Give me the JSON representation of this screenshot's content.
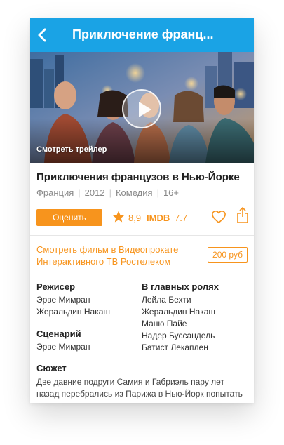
{
  "header": {
    "title": "Приключение франц...",
    "back_icon": "chevron-left-icon"
  },
  "hero": {
    "trailer_label": "Смотреть трейлер",
    "play_icon": "play-icon"
  },
  "movie": {
    "title": "Приключения французов в Нью-Йорке",
    "country": "Франция",
    "year": "2012",
    "genre": "Комедия",
    "age_rating": "16+"
  },
  "actions": {
    "rate_label": "Оценить",
    "rating": "8,9",
    "imdb_label": "IMDB",
    "imdb_rating": "7.7",
    "star_icon": "star-icon",
    "favorite_icon": "heart-icon",
    "share_icon": "share-icon"
  },
  "purchase": {
    "line1": "Смотреть фильм в Видеопрокате",
    "line2": "Интерактивного ТВ Ростелеком",
    "price": "200 руб"
  },
  "credits": {
    "director_heading": "Режисер",
    "directors": [
      "Эрве Мимран",
      "Жеральдин Накаш"
    ],
    "writer_heading": "Сценарий",
    "writers": [
      "Эрве Мимран"
    ],
    "cast_heading": "В главных ролях",
    "cast": [
      "Лейла Бехти",
      "Жеральдин Накаш",
      "Маню Пайе",
      "Надер Буссандель",
      "Батист Лекаплен"
    ]
  },
  "plot": {
    "heading": "Сюжет",
    "text": "Две давние подруги Самия и Габриэль пару лет назад перебрались из Парижа в Нью-Йорк попытать"
  },
  "colors": {
    "accent": "#1aa3e5",
    "orange": "#f7941d"
  }
}
